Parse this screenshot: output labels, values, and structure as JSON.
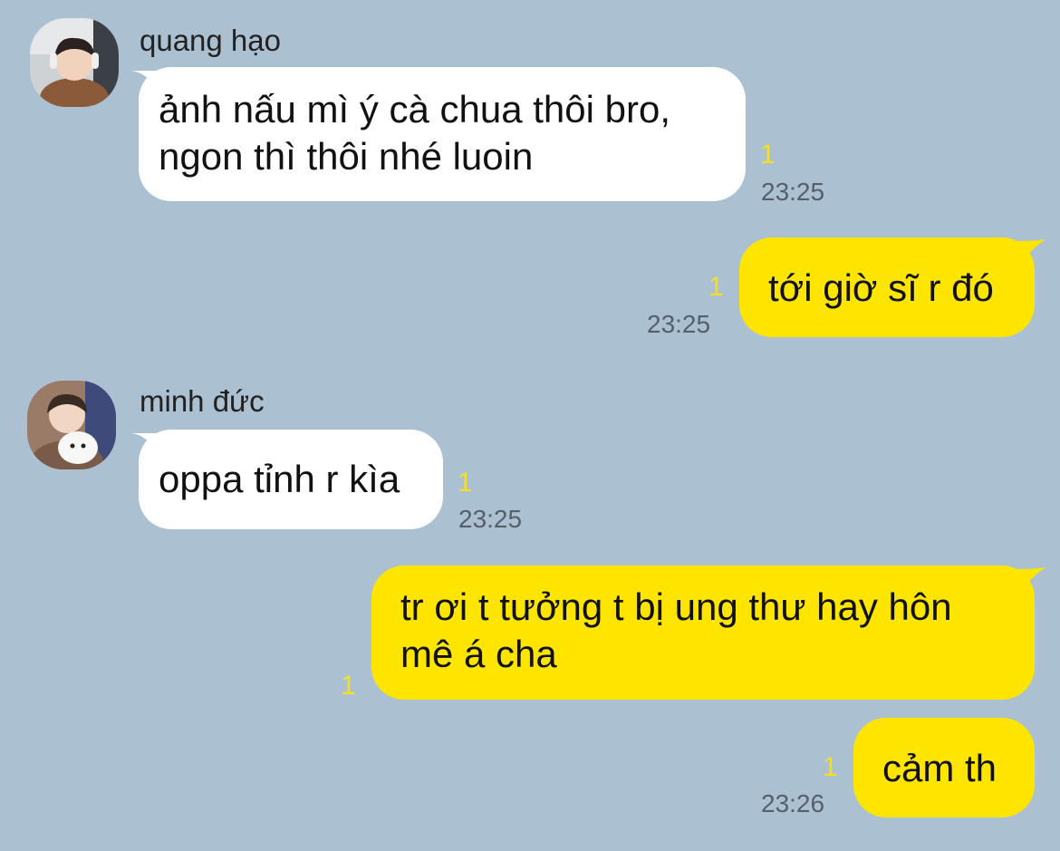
{
  "messages": [
    {
      "direction": "incoming",
      "sender": "quang hạo",
      "lines": [
        "ảnh nấu mì ý cà chua thôi bro,",
        "ngon thì thôi nhé luoin"
      ],
      "unread": "1",
      "time": "23:25"
    },
    {
      "direction": "outgoing",
      "lines": [
        "tới giờ sĩ r đó"
      ],
      "unread": "1",
      "time": "23:25"
    },
    {
      "direction": "incoming",
      "sender": "minh đức",
      "lines": [
        "oppa tỉnh r kìa"
      ],
      "unread": "1",
      "time": "23:25"
    },
    {
      "direction": "outgoing",
      "lines": [
        "tr ơi t tưởng t bị ung thư hay hôn",
        "mê á cha"
      ],
      "unread": "1",
      "time": ""
    },
    {
      "direction": "outgoing",
      "lines": [
        "cảm th"
      ],
      "unread": "1",
      "time": "23:26"
    }
  ],
  "colors": {
    "background": "#abc1d1",
    "incoming_bubble": "#ffffff",
    "outgoing_bubble": "#fee500",
    "unread": "#f5df24",
    "timestamp": "#55606b"
  },
  "icons": [
    "avatar-photo-quang-hao",
    "avatar-photo-minh-duc"
  ]
}
